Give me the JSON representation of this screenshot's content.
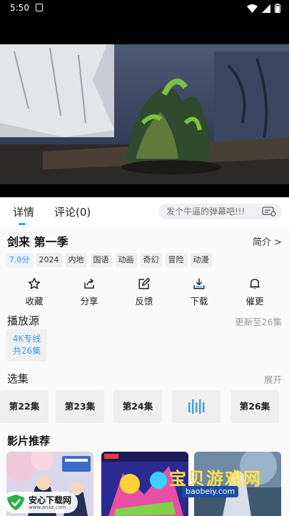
{
  "status_bar": {
    "time": "5:50"
  },
  "tabs": [
    {
      "label": "详情"
    },
    {
      "label": "评论(0)"
    }
  ],
  "danmaku": {
    "placeholder": "发个牛逼的弹幕吧!!!"
  },
  "show": {
    "title": "剑来 第一季",
    "intro_link": "简介 >",
    "tags": [
      "7.0分",
      "2024",
      "内地",
      "国语",
      "动画",
      "奇幻",
      "冒险",
      "动漫"
    ]
  },
  "actions": [
    {
      "label": "收藏",
      "icon": "star-icon"
    },
    {
      "label": "分享",
      "icon": "share-icon"
    },
    {
      "label": "反馈",
      "icon": "edit-icon"
    },
    {
      "label": "下载",
      "icon": "download-icon"
    },
    {
      "label": "催更",
      "icon": "bell-icon"
    }
  ],
  "source": {
    "label": "播放源",
    "update_note": "更新至26集",
    "card_line1": "4K专线",
    "card_line2": "共26集"
  },
  "episodes": {
    "label": "选集",
    "expand": "展开",
    "items": [
      "第22集",
      "第23集",
      "第24集",
      "",
      "第26集"
    ],
    "playing_index": 3
  },
  "recommend": {
    "title": "影片推荐"
  },
  "watermarks": {
    "left_text": "安心下载网",
    "left_url": "www.anxz.com",
    "right_text": "宝贝游戏网",
    "right_url": "baobeiy.com"
  },
  "colors": {
    "accent": "#3ea0e6",
    "score_bg": "#e8f2fc",
    "tag_bg": "#efefef"
  }
}
